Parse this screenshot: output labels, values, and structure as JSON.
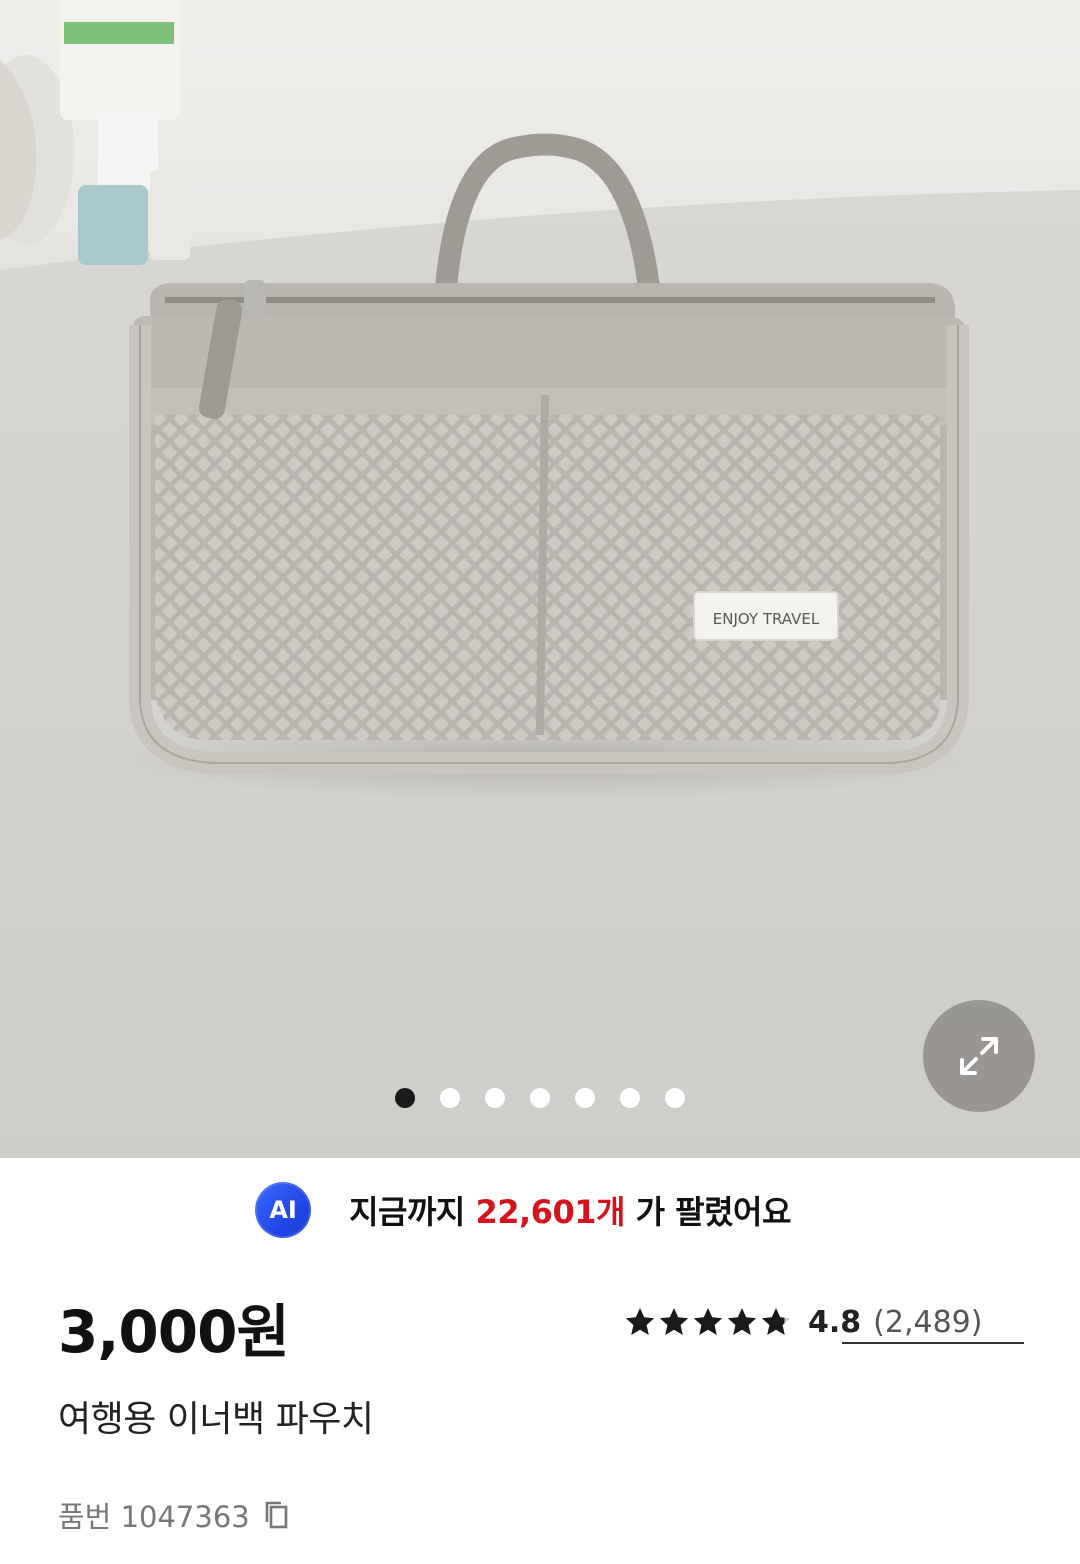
{
  "gallery": {
    "product_label": "ENJOY TRAVEL",
    "slide_count": 7,
    "active_slide": 1,
    "expand_icon": "expand-arrows-icon"
  },
  "sold": {
    "badge": "AI",
    "prefix": "지금까지 ",
    "count": "22,601개",
    "suffix": " 가 팔렸어요"
  },
  "product": {
    "price": "3,000원",
    "name": "여행용 이너백 파우치",
    "sku_label": "품번 1047363",
    "copy_icon": "copy-icon"
  },
  "rating": {
    "stars": 4.8,
    "value": "4.8",
    "count": "(2,489)"
  },
  "colors": {
    "accent_red": "#d6131d",
    "ai_blue": "#2247e6"
  }
}
